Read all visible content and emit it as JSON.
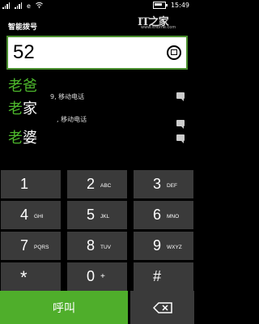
{
  "status_bar": {
    "data_icon": "e",
    "time": "15:49"
  },
  "watermark": {
    "logo": "IT之家",
    "url": "www.ithome.com"
  },
  "app": {
    "title": "智能拨号"
  },
  "dial_field": {
    "value": "52"
  },
  "suggestions": [
    {
      "name_highlight": "老爸",
      "name_rest": "",
      "subtitle": "9, 移动电话"
    },
    {
      "name_highlight": "老",
      "name_rest": "家",
      "subtitle": ", 移动电话"
    },
    {
      "name_highlight": "老",
      "name_rest": "婆",
      "subtitle": ""
    }
  ],
  "keypad": [
    {
      "digit": "1",
      "letters": ""
    },
    {
      "digit": "2",
      "letters": "ABC"
    },
    {
      "digit": "3",
      "letters": "DEF"
    },
    {
      "digit": "4",
      "letters": "GHI"
    },
    {
      "digit": "5",
      "letters": "JKL"
    },
    {
      "digit": "6",
      "letters": "MNO"
    },
    {
      "digit": "7",
      "letters": "PQRS"
    },
    {
      "digit": "8",
      "letters": "TUV"
    },
    {
      "digit": "9",
      "letters": "WXYZ"
    },
    {
      "digit": "*",
      "letters": ""
    },
    {
      "digit": "0",
      "letters": "+"
    },
    {
      "digit": "#",
      "letters": ""
    }
  ],
  "actions": {
    "call_label": "呼叫",
    "delete_icon": "backspace-icon"
  },
  "colors": {
    "accent": "#4fae2b",
    "key_bg": "#3a3a3a",
    "highlight_text": "#4db82c"
  }
}
